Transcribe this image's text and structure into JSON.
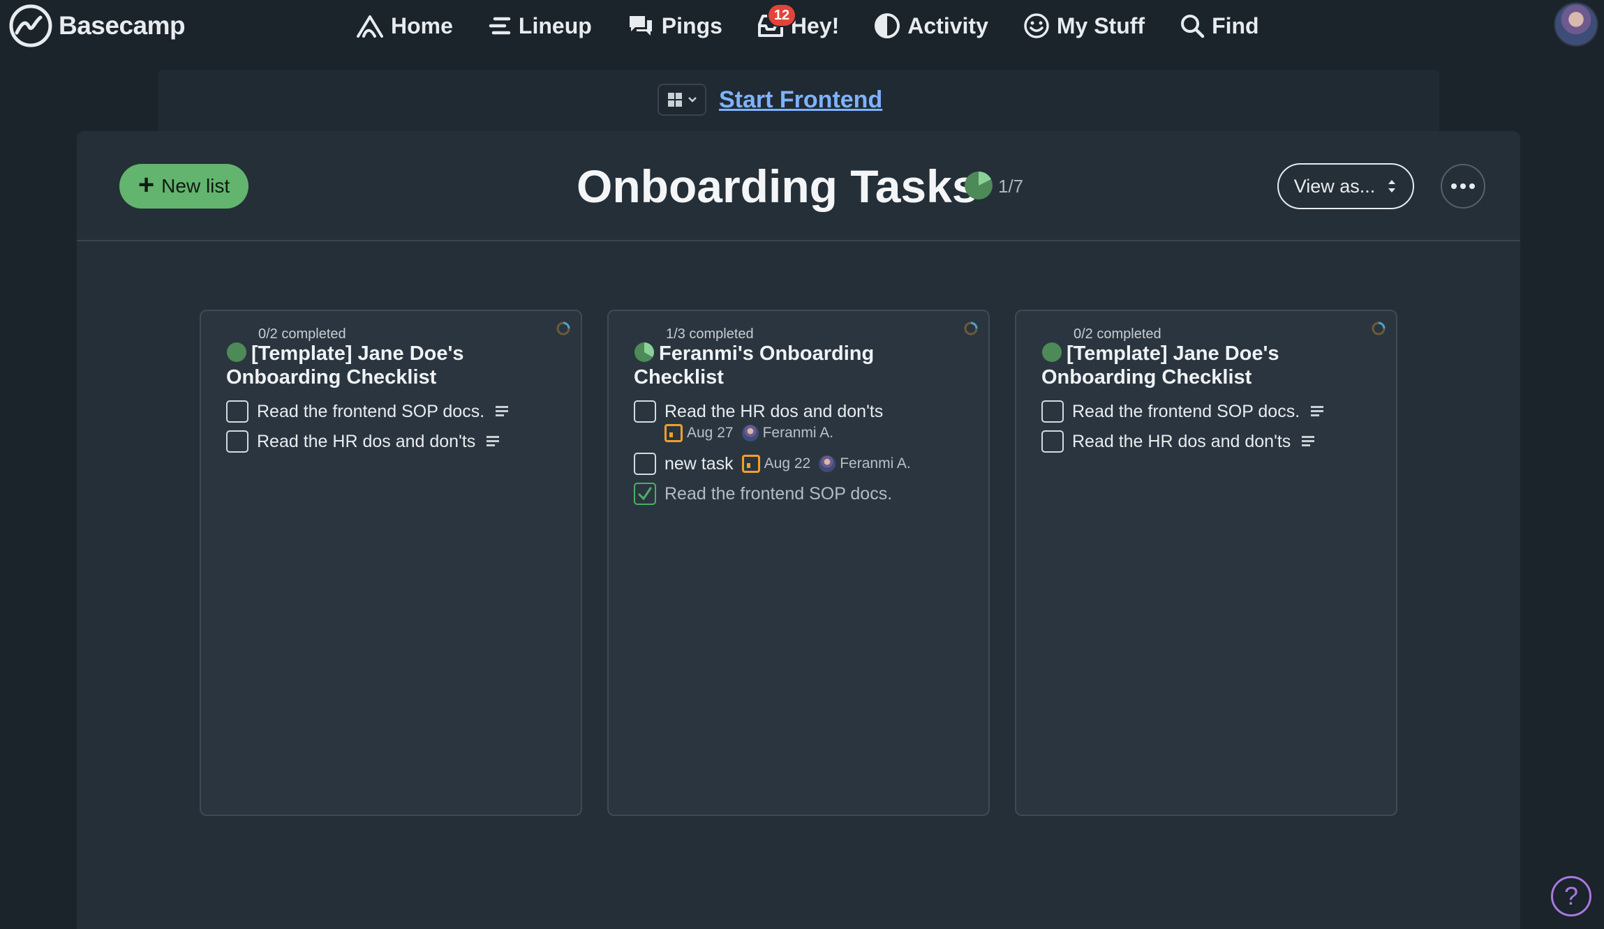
{
  "app": {
    "name": "Basecamp"
  },
  "nav": {
    "home": "Home",
    "lineup": "Lineup",
    "pings": "Pings",
    "hey": "Hey!",
    "hey_badge": "12",
    "activity": "Activity",
    "my_stuff": "My Stuff",
    "find": "Find"
  },
  "breadcrumb": {
    "project": "Start Frontend"
  },
  "header": {
    "new_list": "New list",
    "title": "Onboarding Tasks",
    "progress": "1/7",
    "view_as": "View as..."
  },
  "lists": [
    {
      "completed": "0/2 completed",
      "title": "[Template] Jane Doe's Onboarding Checklist",
      "todos": [
        {
          "text": "Read the frontend SOP docs."
        },
        {
          "text": "Read the HR dos and don'ts"
        }
      ]
    },
    {
      "completed": "1/3 completed",
      "title": "Feranmi's Onboarding Checklist",
      "todos": [
        {
          "text": "Read the HR dos and don'ts",
          "date": "Aug 27",
          "assignee": "Feranmi A."
        },
        {
          "text": "new task",
          "date": "Aug 22",
          "assignee": "Feranmi A."
        },
        {
          "text": "Read the frontend SOP docs."
        }
      ]
    },
    {
      "completed": "0/2 completed",
      "title": "[Template] Jane Doe's Onboarding Checklist",
      "todos": [
        {
          "text": "Read the frontend SOP docs."
        },
        {
          "text": "Read the HR dos and don'ts"
        }
      ]
    }
  ],
  "help": "?",
  "colors": {
    "accent_green": "#63b46e",
    "link_blue": "#7fb2ff",
    "badge_red": "#e2443a",
    "date_orange": "#f0a02a",
    "help_purple": "#a779e0"
  }
}
